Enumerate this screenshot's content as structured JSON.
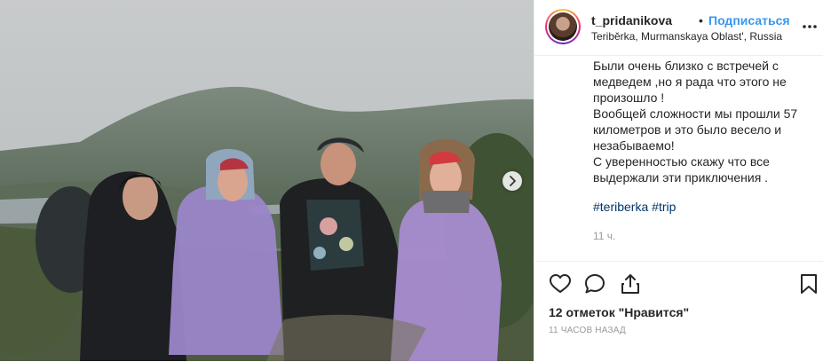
{
  "post": {
    "username": "t_pridanikova",
    "separator": "•",
    "follow_label": "Подписаться",
    "location": "Teriběrka, Murmanskaya Oblast', Russia",
    "caption": "Были очень близко с встречей с\nмедведем ,но я рада что этого не\nпроизошло !\nВообщей сложности мы прошли 57\nкилометров и это было весело и\nнезабываемо!\nС уверенностью скажу что все\nвыдержали эти приключения .",
    "hashtags": [
      "#teriberka",
      "#trip"
    ],
    "caption_age": "11 ч.",
    "likes_text": "12 отметок \"Нравится\"",
    "posted_ago": "11 часов назад"
  },
  "icons": {
    "more": "more-horizontal-icon",
    "like": "heart-icon",
    "comment": "comment-icon",
    "share": "share-icon",
    "save": "bookmark-icon",
    "next": "chevron-right-icon"
  },
  "colors": {
    "link_blue": "#3897f0",
    "hashtag": "#003569",
    "text": "#262626",
    "muted": "#999999"
  }
}
